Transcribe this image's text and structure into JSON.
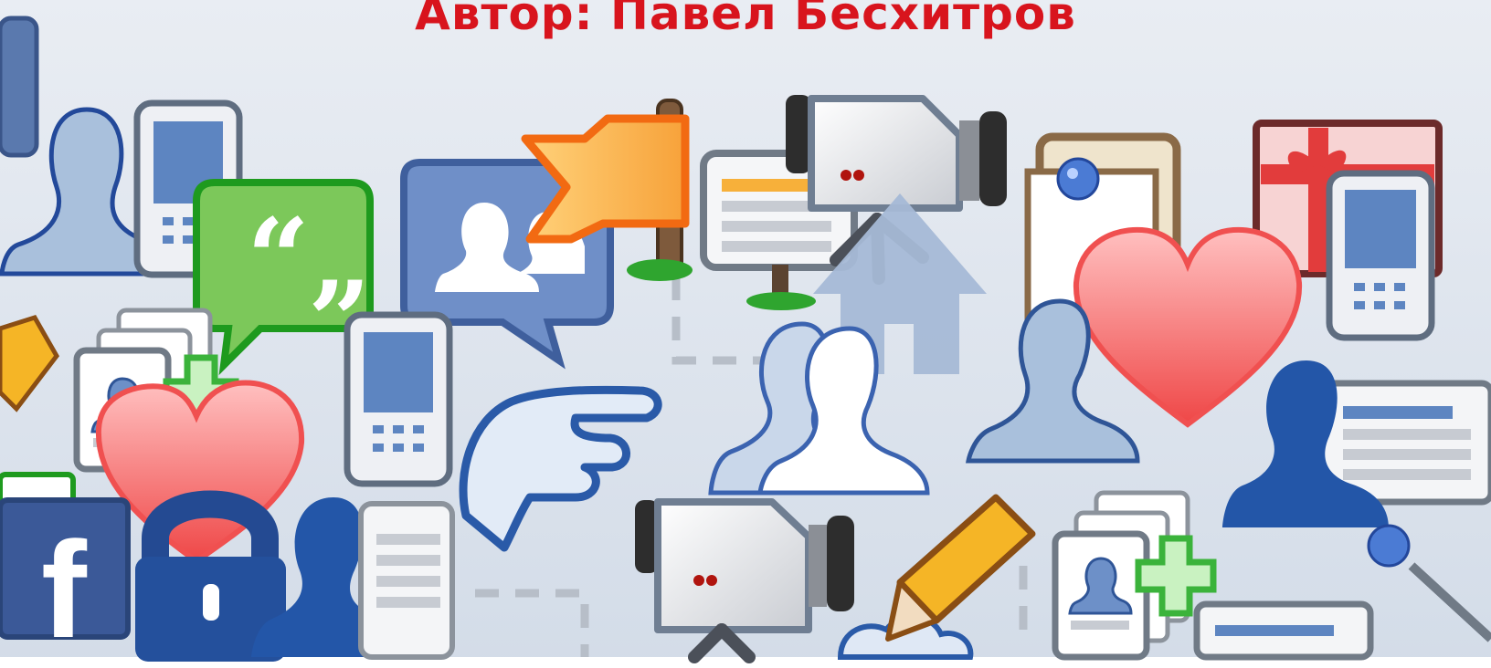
{
  "caption": {
    "text": "Автор: Павел Бесхитров",
    "color": "#d8141d"
  },
  "colors": {
    "background": "#dde4ee",
    "facebook_blue": "#3b5998",
    "silhouette_light": "#a5bcd9",
    "silhouette_dark": "#2f5597",
    "speech_green": "#43a92a",
    "flag_orange": "#f58a1f",
    "heart_red": "#f04848",
    "pencil_yellow": "#f5b526"
  },
  "icons": [
    "person-silhouette-icon",
    "mobile-phone-icon",
    "quote-speech-bubble-icon",
    "friends-speech-bubble-icon",
    "flag-icon",
    "monitor-icon",
    "video-camera-icon",
    "note-with-pin-icon",
    "gift-box-icon",
    "heart-icon",
    "pencil-icon",
    "add-contact-icon",
    "pointing-hand-icon",
    "home-icon",
    "facebook-logo-icon",
    "padlock-icon",
    "document-icon"
  ]
}
